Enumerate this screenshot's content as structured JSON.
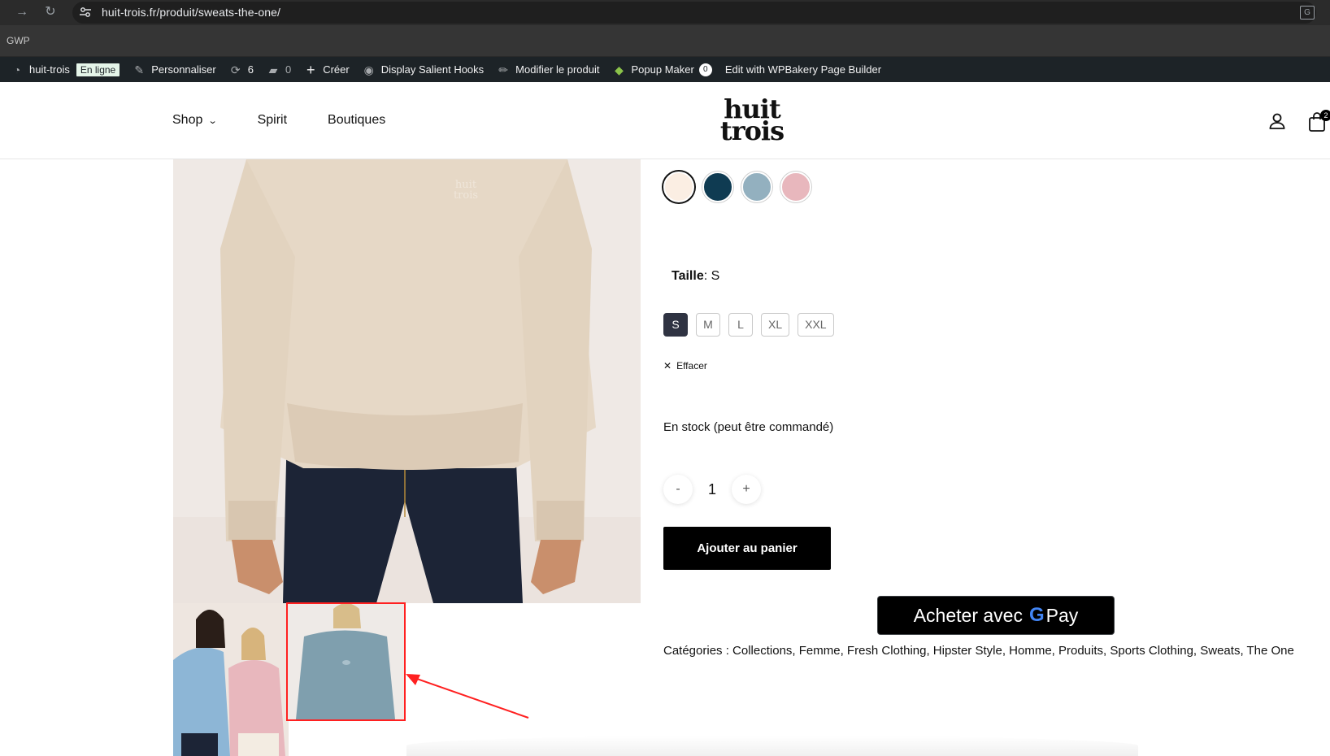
{
  "browser": {
    "url": "huit-trois.fr/produit/sweats-the-one/",
    "bookmark": "GWP"
  },
  "wpbar": {
    "site": "huit-trois",
    "status": "En ligne",
    "customize": "Personnaliser",
    "updates": "6",
    "comments": "0",
    "create": "Créer",
    "hooks": "Display Salient Hooks",
    "edit_product": "Modifier le produit",
    "popup": "Popup Maker",
    "popup_count": "0",
    "wpbakery": "Edit with WPBakery Page Builder"
  },
  "header": {
    "menu": [
      "Shop",
      "Spirit",
      "Boutiques"
    ],
    "logo_line1": "huit",
    "logo_line2": "trois",
    "cart_count": "2"
  },
  "product": {
    "swatch_colors": [
      "#fbeee3",
      "#0f3b52",
      "#93b0bf",
      "#e8b7bd"
    ],
    "size_label": "Taille",
    "size_value": ": S",
    "sizes": [
      "S",
      "M",
      "L",
      "XL",
      "XXL"
    ],
    "selected_size": "S",
    "clear": "Effacer",
    "stock": "En stock (peut être commandé)",
    "qty_minus": "-",
    "qty": "1",
    "qty_plus": "+",
    "add_to_cart": "Ajouter au panier",
    "gpay_text": "Acheter avec",
    "gpay_g": "G",
    "gpay_pay": "Pay",
    "categories": "Catégories : Collections, Femme, Fresh Clothing, Hipster Style, Homme, Produits, Sports Clothing, Sweats, The One"
  },
  "colors": {
    "accent_annotation": "#ff2020",
    "size_selected": "#2f3342"
  }
}
